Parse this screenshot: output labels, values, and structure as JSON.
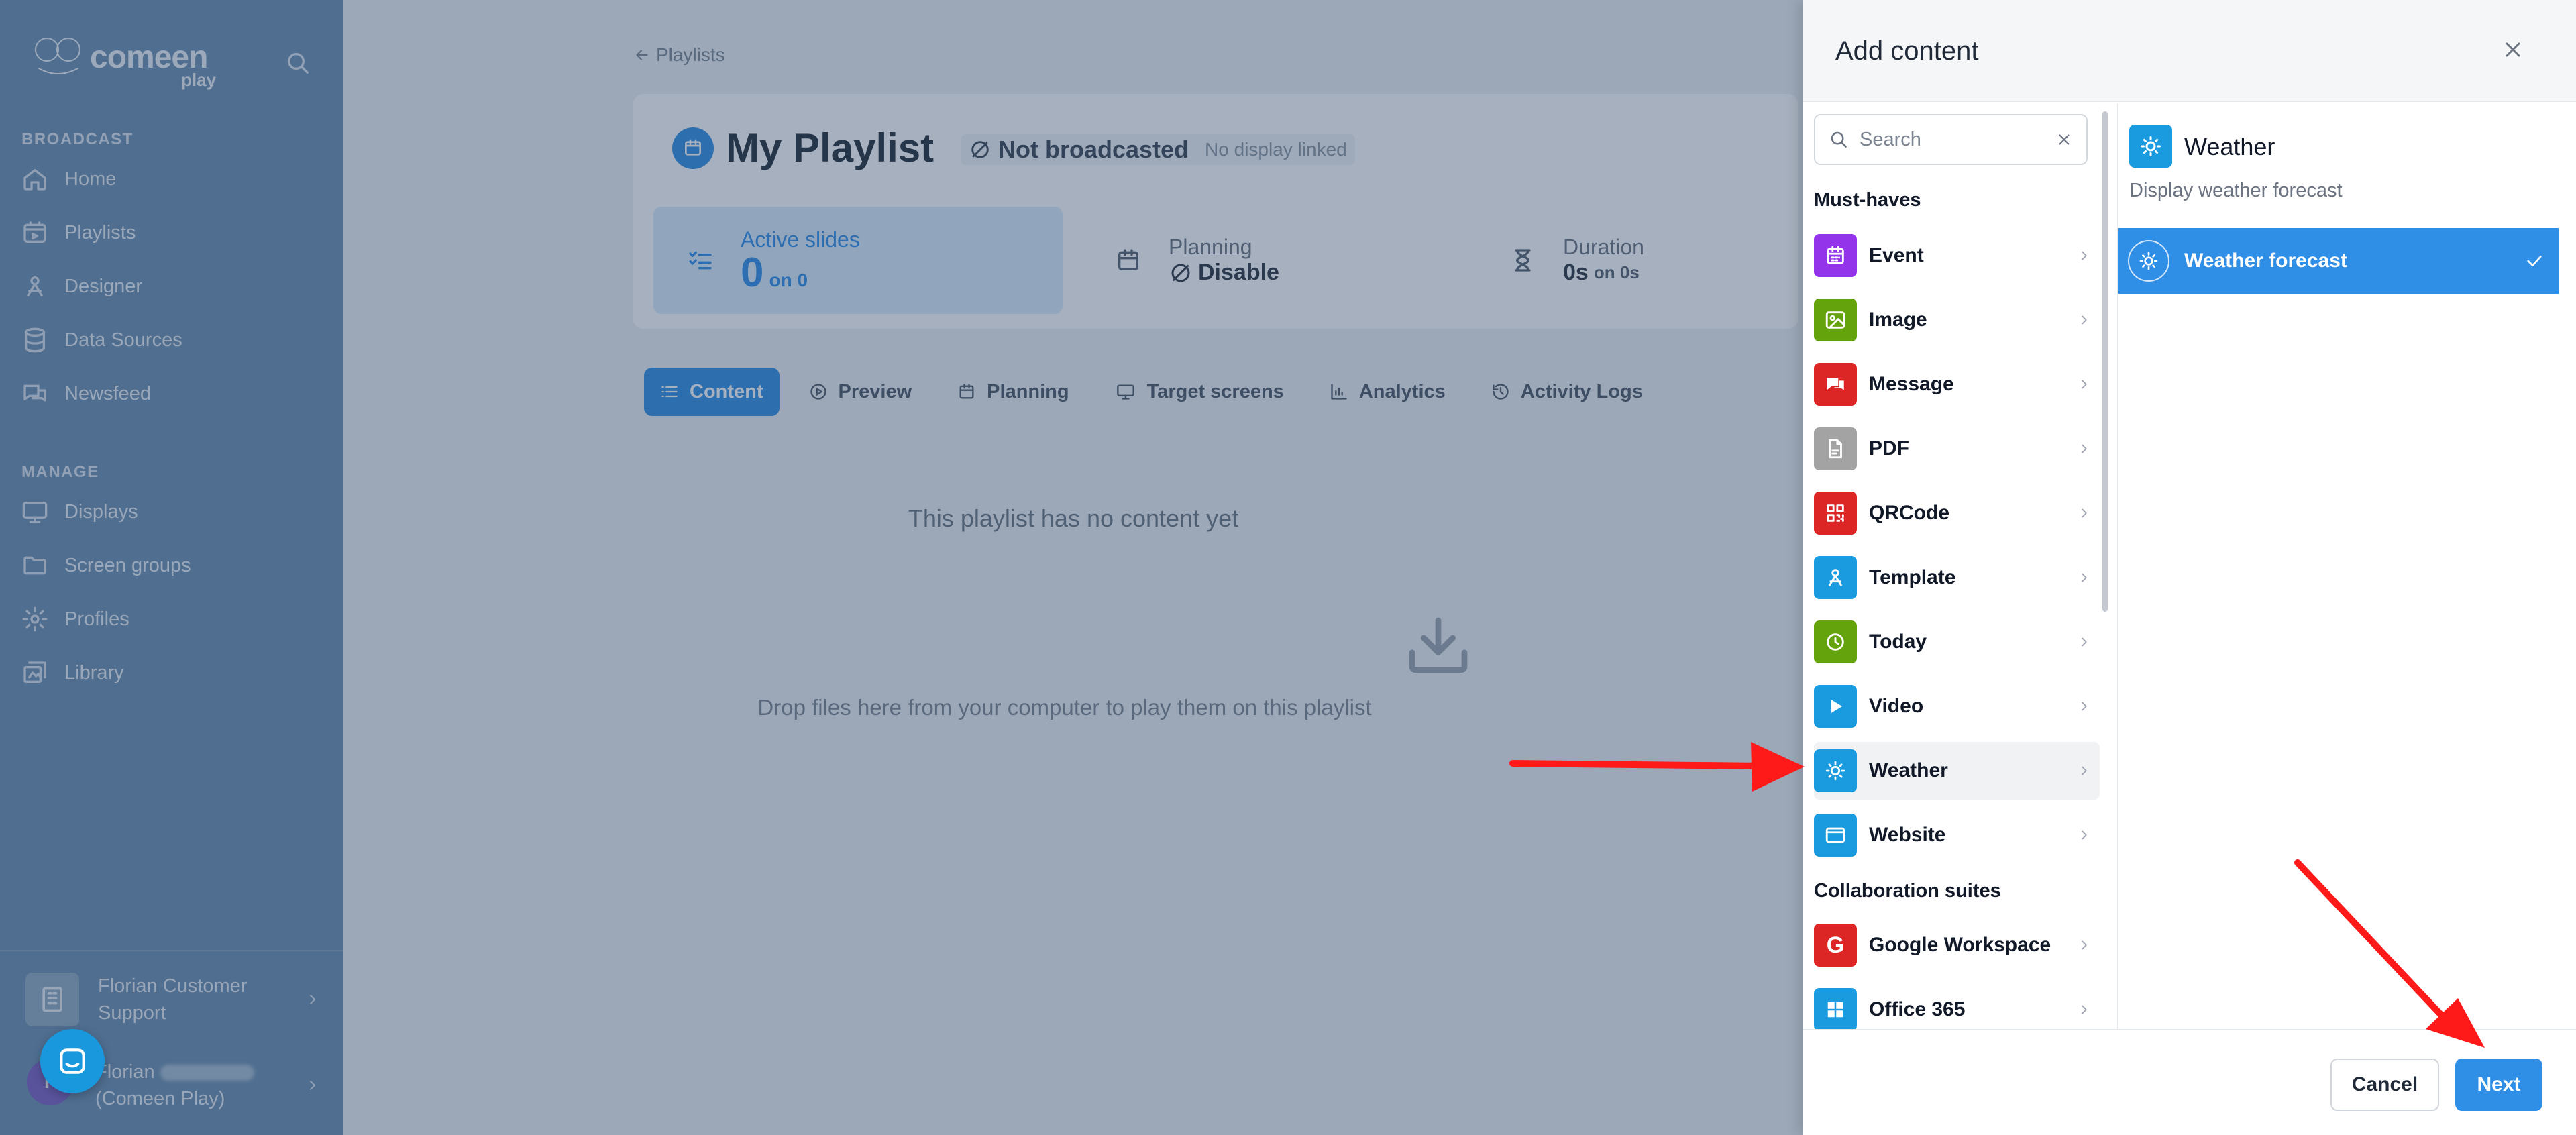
{
  "sidebar": {
    "logo_word": "comeen",
    "logo_sub": "play",
    "broadcast_label": "BROADCAST",
    "manage_label": "MANAGE",
    "broadcast_items": [
      {
        "label": "Home",
        "icon": "home-icon"
      },
      {
        "label": "Playlists",
        "icon": "playlist-icon"
      },
      {
        "label": "Designer",
        "icon": "designer-icon"
      },
      {
        "label": "Data Sources",
        "icon": "database-icon"
      },
      {
        "label": "Newsfeed",
        "icon": "newsfeed-icon"
      }
    ],
    "manage_items": [
      {
        "label": "Displays",
        "icon": "monitor-icon"
      },
      {
        "label": "Screen groups",
        "icon": "folder-icon"
      },
      {
        "label": "Profiles",
        "icon": "gear-icon"
      },
      {
        "label": "Library",
        "icon": "library-icon"
      }
    ],
    "account_org": "Florian Customer Support",
    "account_user_first": "Florian",
    "account_user_org": "(Comeen Play)",
    "avatar_initial": "F"
  },
  "main": {
    "breadcrumb": "Playlists",
    "title": "My Playlist",
    "status": "Not broadcasted",
    "status_sub": "No display linked",
    "stats": {
      "active_label": "Active slides",
      "active_value": "0",
      "active_of": "on 0",
      "planning_label": "Planning",
      "planning_value": "Disable",
      "duration_label": "Duration",
      "duration_value": "0s",
      "duration_of": "on 0s"
    },
    "tabs": [
      {
        "label": "Content",
        "active": true
      },
      {
        "label": "Preview"
      },
      {
        "label": "Planning"
      },
      {
        "label": "Target screens"
      },
      {
        "label": "Analytics"
      },
      {
        "label": "Activity Logs"
      }
    ],
    "empty_title": "This playlist has no content yet",
    "drop_text": "Drop files here from your computer to play them on this playlist"
  },
  "modal": {
    "title": "Add content",
    "search_placeholder": "Search",
    "group_musthaves": "Must-haves",
    "group_collab": "Collaboration suites",
    "items": [
      {
        "label": "Event",
        "color": "#9333ea",
        "icon": "calendar-icon"
      },
      {
        "label": "Image",
        "color": "#65a30d",
        "icon": "image-icon"
      },
      {
        "label": "Message",
        "color": "#dc2626",
        "icon": "chat-icon"
      },
      {
        "label": "PDF",
        "color": "#a3a3a3",
        "icon": "pdf-icon"
      },
      {
        "label": "QRCode",
        "color": "#dc2626",
        "icon": "qrcode-icon"
      },
      {
        "label": "Template",
        "color": "#1a9be0",
        "icon": "template-icon"
      },
      {
        "label": "Today",
        "color": "#65a30d",
        "icon": "clock-icon"
      },
      {
        "label": "Video",
        "color": "#1a9be0",
        "icon": "play-icon"
      },
      {
        "label": "Weather",
        "color": "#1a9be0",
        "icon": "sun-icon",
        "selected": true
      },
      {
        "label": "Website",
        "color": "#1a9be0",
        "icon": "browser-icon"
      }
    ],
    "collab_items": [
      {
        "label": "Google Workspace",
        "color": "#dc2626",
        "icon": "google-icon"
      },
      {
        "label": "Office 365",
        "color": "#1a9be0",
        "icon": "office-icon"
      }
    ],
    "detail": {
      "title": "Weather",
      "description": "Display weather forecast",
      "option": "Weather forecast"
    },
    "cancel_label": "Cancel",
    "next_label": "Next"
  },
  "colors": {
    "accent": "#2f8ee5",
    "annotation_arrow": "#ff1a1a"
  }
}
